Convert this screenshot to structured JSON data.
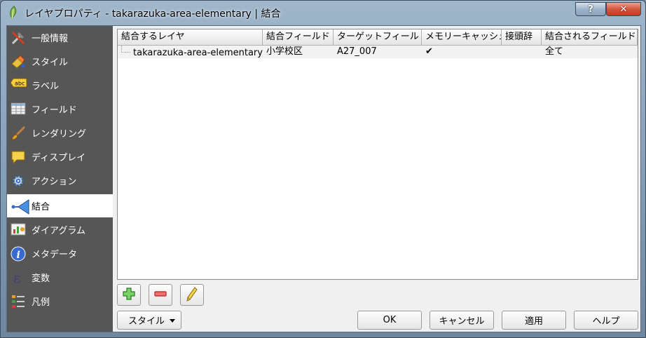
{
  "window": {
    "title": "レイヤプロパティ - takarazuka-area-elementary | 結合",
    "help_label": "?",
    "close_label": "✕"
  },
  "sidebar": {
    "items": [
      {
        "label": "一般情報",
        "icon": "tools-icon"
      },
      {
        "label": "スタイル",
        "icon": "style-icon"
      },
      {
        "label": "ラベル",
        "icon": "label-icon"
      },
      {
        "label": "フィールド",
        "icon": "table-icon"
      },
      {
        "label": "レンダリング",
        "icon": "brush-icon"
      },
      {
        "label": "ディスプレイ",
        "icon": "speech-bubble-icon"
      },
      {
        "label": "アクション",
        "icon": "gear-icon"
      },
      {
        "label": "結合",
        "icon": "join-icon"
      },
      {
        "label": "ダイアグラム",
        "icon": "diagram-icon"
      },
      {
        "label": "メタデータ",
        "icon": "info-icon"
      },
      {
        "label": "変数",
        "icon": "variable-icon"
      },
      {
        "label": "凡例",
        "icon": "legend-icon"
      }
    ],
    "active_index": 7,
    "label_icon_text": "abc"
  },
  "joins_table": {
    "columns": [
      "結合するレイヤ",
      "結合フィールド",
      "ターゲットフィールド",
      "メモリーキャッシュ",
      "接頭辞",
      "結合されるフィールド"
    ],
    "rows": [
      [
        "takarazuka-area-elementary",
        "小学校区",
        "A27_007",
        "✔",
        "",
        "全て"
      ]
    ]
  },
  "toolbar": {
    "add": "add-join-icon",
    "remove": "remove-join-icon",
    "edit": "edit-join-icon"
  },
  "buttons": {
    "style": "スタイル",
    "ok": "OK",
    "cancel": "キャンセル",
    "apply": "適用",
    "help": "ヘルプ"
  }
}
